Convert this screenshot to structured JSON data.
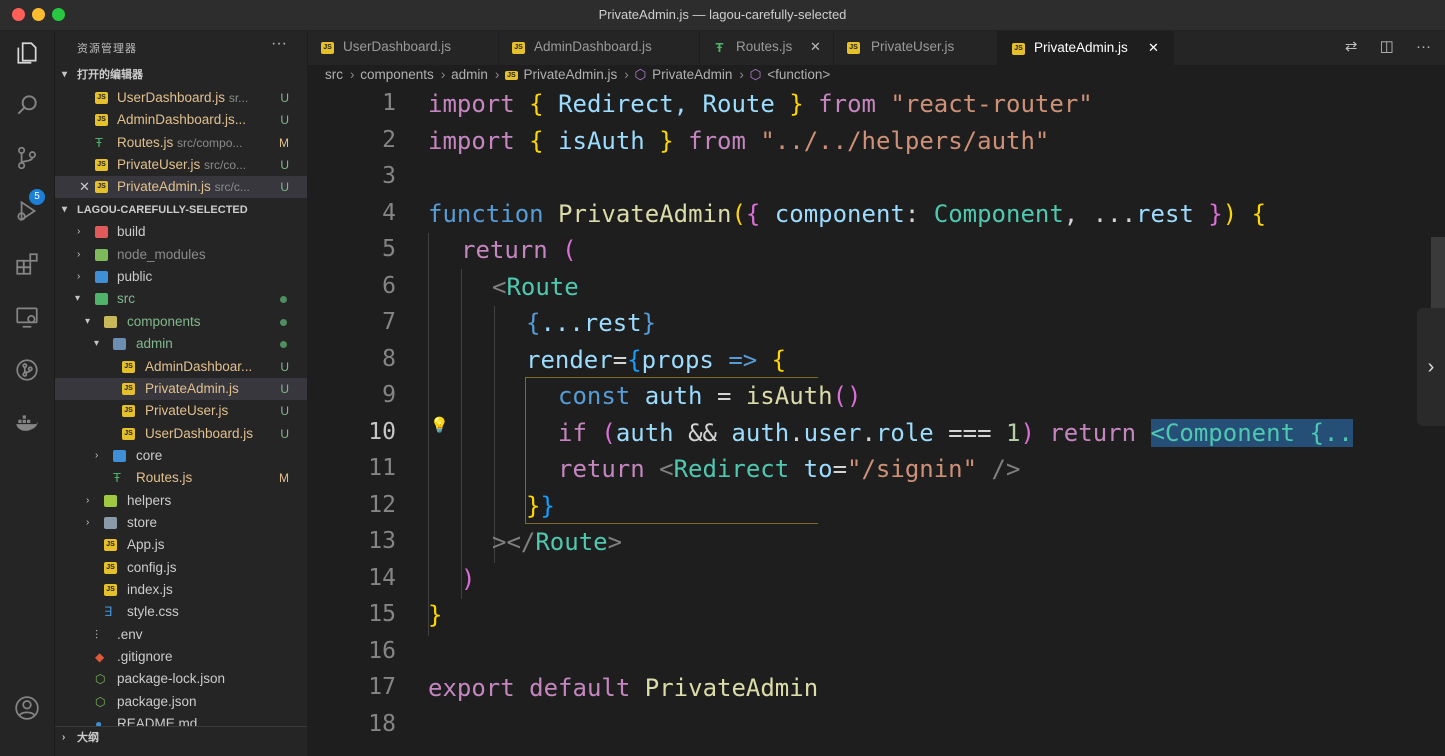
{
  "window": {
    "title": "PrivateAdmin.js — lagou-carefully-selected"
  },
  "sidebar": {
    "header": "资源管理器",
    "more": "···",
    "open_editors_title": "打开的编辑器",
    "open_editors": [
      {
        "name": "UserDashboard.js",
        "path": "sr...",
        "status": "U"
      },
      {
        "name": "AdminDashboard.js...",
        "path": "",
        "status": "U"
      },
      {
        "name": "Routes.js",
        "path": "src/compo...",
        "status": "M"
      },
      {
        "name": "PrivateUser.js",
        "path": "src/co...",
        "status": "U"
      },
      {
        "name": "PrivateAdmin.js",
        "path": "src/c...",
        "status": "U"
      }
    ],
    "project_title": "LAGOU-CAREFULLY-SELECTED",
    "tree": [
      {
        "name": "build"
      },
      {
        "name": "node_modules"
      },
      {
        "name": "public"
      },
      {
        "name": "src"
      },
      {
        "name": "components"
      },
      {
        "name": "admin"
      },
      {
        "name": "AdminDashboar...",
        "status": "U"
      },
      {
        "name": "PrivateAdmin.js",
        "status": "U"
      },
      {
        "name": "PrivateUser.js",
        "status": "U"
      },
      {
        "name": "UserDashboard.js",
        "status": "U"
      },
      {
        "name": "core"
      },
      {
        "name": "Routes.js",
        "status": "M"
      },
      {
        "name": "helpers"
      },
      {
        "name": "store"
      },
      {
        "name": "App.js"
      },
      {
        "name": "config.js"
      },
      {
        "name": "index.js"
      },
      {
        "name": "style.css"
      },
      {
        "name": ".env"
      },
      {
        "name": ".gitignore"
      },
      {
        "name": "package-lock.json"
      },
      {
        "name": "package.json"
      },
      {
        "name": "README.md"
      }
    ],
    "outline_title": "大纲",
    "scm_badge": "5"
  },
  "tabs": [
    {
      "label": "UserDashboard.js"
    },
    {
      "label": "AdminDashboard.js"
    },
    {
      "label": "Routes.js",
      "close": "✕"
    },
    {
      "label": "PrivateUser.js"
    },
    {
      "label": "PrivateAdmin.js",
      "close": "✕"
    }
  ],
  "breadcrumbs": [
    "src",
    "components",
    "admin",
    "PrivateAdmin.js",
    "PrivateAdmin",
    "<function>"
  ],
  "editor": {
    "line_numbers": [
      "1",
      "2",
      "3",
      "4",
      "5",
      "6",
      "7",
      "8",
      "9",
      "10",
      "11",
      "12",
      "13",
      "14",
      "15",
      "16",
      "17",
      "18"
    ],
    "lines": {
      "l1": [
        "import",
        "{",
        "Redirect, Route",
        "}",
        "from",
        "\"react-router\""
      ],
      "l2": [
        "import",
        "{",
        "isAuth",
        "}",
        "from",
        "\"../../helpers/auth\""
      ],
      "l4": [
        "function",
        "PrivateAdmin",
        "(",
        "{",
        "component",
        ":",
        "Component",
        ", ...",
        "rest",
        "}",
        ")",
        "{"
      ],
      "l5": [
        "return",
        "("
      ],
      "l6": [
        "<",
        "Route"
      ],
      "l7": [
        "{",
        "...rest",
        "}"
      ],
      "l8": [
        "render",
        "=",
        "{",
        "props",
        "=>",
        "{"
      ],
      "l9": [
        "const",
        "auth",
        "=",
        "isAuth",
        "()"
      ],
      "l10": [
        "if",
        "(",
        "auth",
        "&&",
        "auth",
        ".",
        "user",
        ".",
        "role",
        "===",
        "1",
        ")",
        "return",
        "<Component {.."
      ],
      "l11": [
        "return",
        "<",
        "Redirect",
        "to",
        "=",
        "\"/signin\"",
        "/>"
      ],
      "l12": [
        "}",
        "}"
      ],
      "l13": [
        ">",
        "</",
        "Route",
        ">"
      ],
      "l14": [
        ")"
      ],
      "l15": [
        "}"
      ],
      "l17": [
        "export",
        "default",
        "PrivateAdmin"
      ]
    }
  }
}
